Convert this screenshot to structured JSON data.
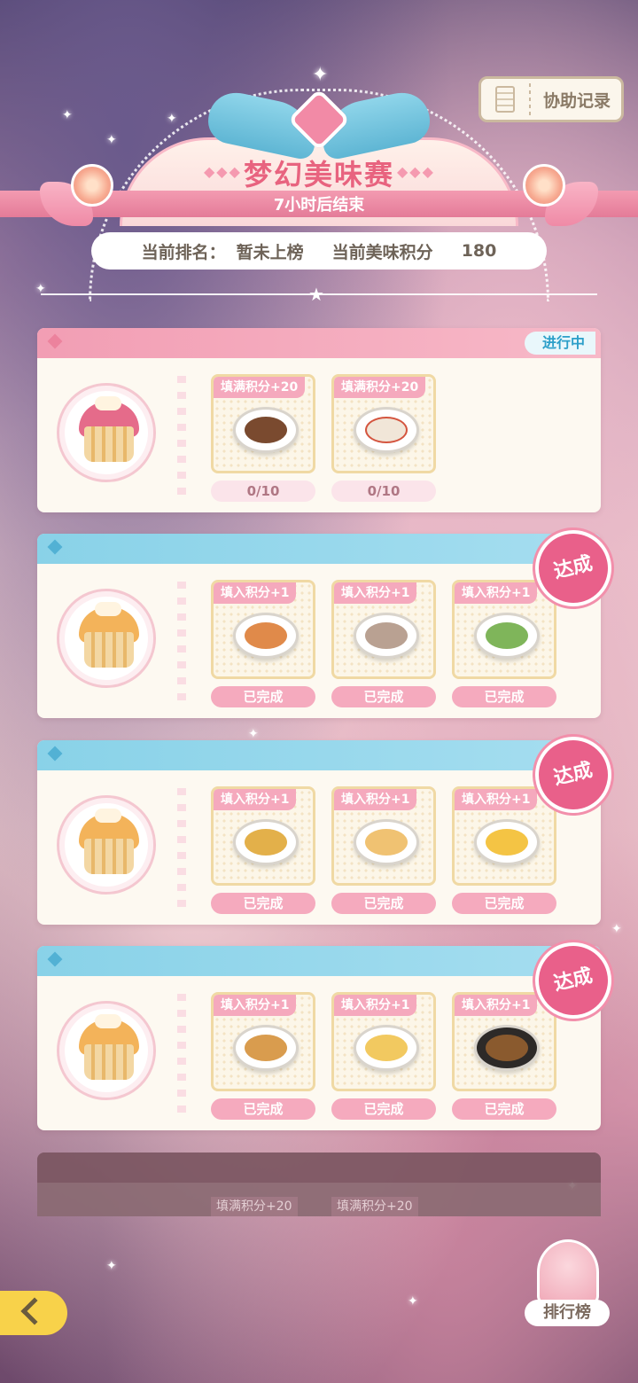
{
  "header": {
    "title": "梦幻美味赛",
    "subtitle": "7小时后结束",
    "assist_label": "协助记录"
  },
  "rank": {
    "rank_label": "当前排名：",
    "rank_value": "暂未上榜",
    "score_label": "当前美味积分",
    "score_value": "180"
  },
  "cards": [
    {
      "status": "进行中",
      "items": [
        {
          "tag": "填满积分+20",
          "button": "0/10",
          "food_color": "#7a4a2f"
        },
        {
          "tag": "填满积分+20",
          "button": "0/10",
          "food_color": "#f1e6d8"
        }
      ]
    },
    {
      "stamp": "达成",
      "items": [
        {
          "tag": "填入积分+1",
          "button": "已完成",
          "food_color": "#e08a4a"
        },
        {
          "tag": "填入积分+1",
          "button": "已完成",
          "food_color": "#b9a192"
        },
        {
          "tag": "填入积分+1",
          "button": "已完成",
          "food_color": "#7fb55a"
        }
      ]
    },
    {
      "stamp": "达成",
      "items": [
        {
          "tag": "填入积分+1",
          "button": "已完成",
          "food_color": "#e3b04a"
        },
        {
          "tag": "填入积分+1",
          "button": "已完成",
          "food_color": "#f0c272"
        },
        {
          "tag": "填入积分+1",
          "button": "已完成",
          "food_color": "#f4c444"
        }
      ]
    },
    {
      "stamp": "达成",
      "items": [
        {
          "tag": "填入积分+1",
          "button": "已完成",
          "food_color": "#d99c4e"
        },
        {
          "tag": "填入积分+1",
          "button": "已完成",
          "food_color": "#f2c960"
        },
        {
          "tag": "填入积分+1",
          "button": "已完成",
          "food_color": "#8a5a2e"
        }
      ]
    }
  ],
  "partial_card": {
    "items": [
      {
        "tag": "填满积分+20"
      },
      {
        "tag": "填满积分+20"
      }
    ]
  },
  "ranking_label": "排行榜"
}
